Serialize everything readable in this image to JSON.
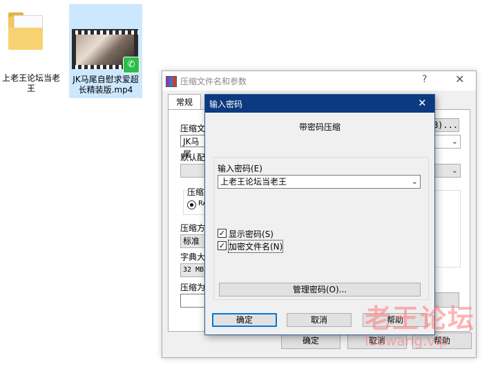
{
  "desktop": {
    "folder_label": "上老王论坛当老王",
    "video_label": "JK马尾自慰求爱超长精装版.mp4",
    "video_badge_icon": "wechat-icon"
  },
  "back_dialog": {
    "title": "压缩文件名和参数",
    "help_glyph": "?",
    "close_glyph": "✕",
    "tab_general": "常规",
    "archive_name_label": "压缩文",
    "archive_name_value": "JK马尾",
    "browse_button": "B)...",
    "default_profile_label": "默认配",
    "format_label": "压缩文",
    "rar_option": "RA",
    "method_label": "压缩方",
    "method_value": "标准",
    "dict_label": "字典大",
    "dict_value": "32 MB",
    "split_label": "压缩为",
    "ok_button": "确定",
    "cancel_button": "取消",
    "help_button": "帮助"
  },
  "password_dialog": {
    "title": "输入密码",
    "close_glyph": "✕",
    "heading": "带密码压缩",
    "password_label": "输入密码(E)",
    "password_value": "上老王论坛当老王",
    "show_password_label": "显示密码(S)",
    "show_password_checked": true,
    "encrypt_names_label": "加密文件名(N)",
    "encrypt_names_checked": true,
    "manage_button": "管理密码(O)...",
    "ok_button": "确定",
    "cancel_button": "取消",
    "help_button": "帮助"
  },
  "watermark": {
    "line1": "老王论坛",
    "line2": "laowang.vip"
  },
  "colors": {
    "accent": "#0078d7",
    "title_bar": "#0c3a80"
  }
}
